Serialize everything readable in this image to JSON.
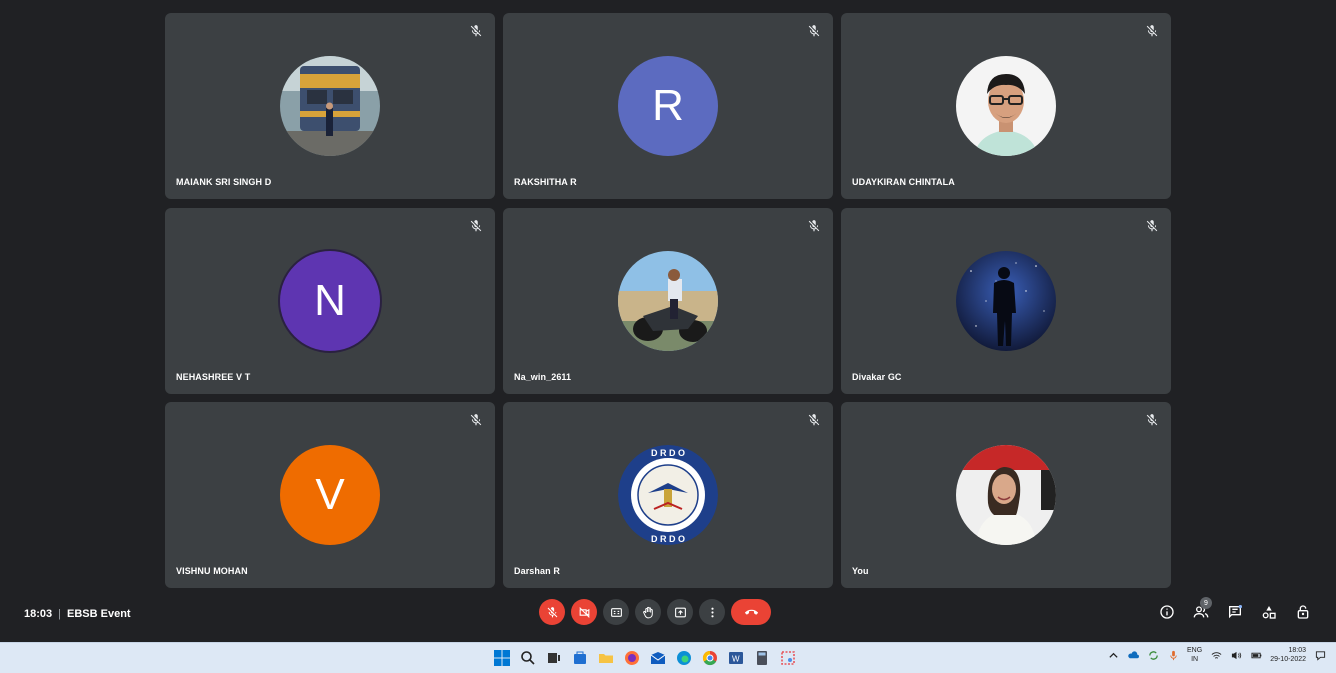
{
  "meeting": {
    "time": "18:03",
    "separator": "|",
    "title": "EBSB Event"
  },
  "participants": [
    {
      "name": "MAIANK SRI SINGH D",
      "avatar_type": "photo",
      "photo": "train"
    },
    {
      "name": "RAKSHITHA R",
      "avatar_type": "letter",
      "letter": "R",
      "color": "#5c6bc0"
    },
    {
      "name": "UDAYKIRAN CHINTALA",
      "avatar_type": "photo",
      "photo": "man-glasses"
    },
    {
      "name": "NEHASHREE V T",
      "avatar_type": "letter",
      "letter": "N",
      "color": "#5e35b1"
    },
    {
      "name": "Na_win_2611",
      "avatar_type": "photo",
      "photo": "bike"
    },
    {
      "name": "Divakar GC",
      "avatar_type": "photo",
      "photo": "stars-silhouette"
    },
    {
      "name": "VISHNU MOHAN",
      "avatar_type": "letter",
      "letter": "V",
      "color": "#ef6c00"
    },
    {
      "name": "Darshan R",
      "avatar_type": "photo",
      "photo": "drdo-logo",
      "logo_text": {
        "top": "D R D O",
        "bottom": "D R D O"
      }
    },
    {
      "name": "You",
      "avatar_type": "photo",
      "photo": "woman"
    }
  ],
  "controls": {
    "mic": {
      "icon": "mic-off-icon"
    },
    "camera": {
      "icon": "camera-off-icon"
    },
    "captions": {
      "icon": "captions-icon"
    },
    "hand": {
      "icon": "raise-hand-icon"
    },
    "present": {
      "icon": "present-icon"
    },
    "more": {
      "icon": "more-options-icon"
    },
    "end": {
      "icon": "end-call-icon"
    }
  },
  "right_controls": {
    "people_count": "9"
  },
  "taskbar": {
    "lang_top": "ENG",
    "lang_bottom": "IN",
    "time": "18:03",
    "date": "29-10-2022"
  },
  "colors": {
    "background": "#202124",
    "tile": "#3c4043",
    "danger": "#ea4335",
    "taskbar": "#dde8f5"
  }
}
